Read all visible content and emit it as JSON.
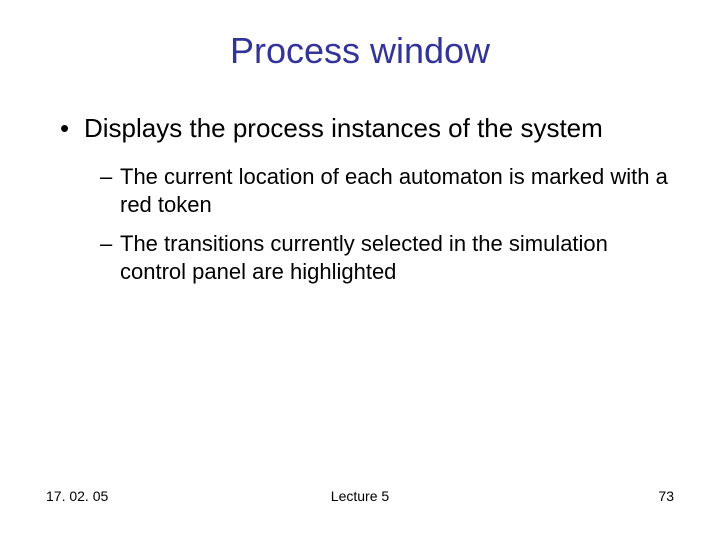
{
  "title": "Process window",
  "bullets": {
    "l1": "Displays the process instances of the system",
    "l2a": "The current location of each automaton is marked with a red token",
    "l2b": "The transitions currently selected in the simulation control panel are highlighted"
  },
  "footer": {
    "date": "17. 02. 05",
    "center": "Lecture 5",
    "page": "73"
  },
  "colors": {
    "title": "#333399",
    "text": "#000000"
  }
}
